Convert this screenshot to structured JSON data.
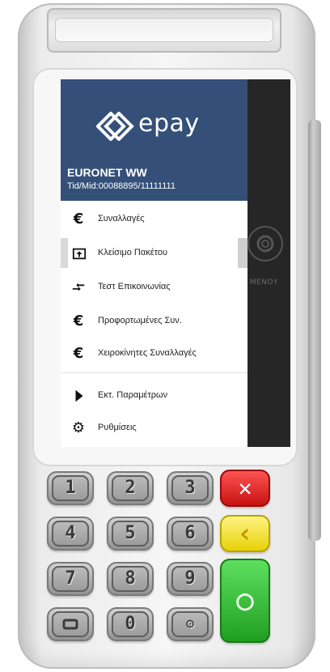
{
  "header": {
    "brand": "epay",
    "company": "EURONET WW",
    "tid_mid": "Tid/Mid:00088895/11111111",
    "color": "#345079"
  },
  "menu": {
    "items": [
      {
        "icon": "euro-icon",
        "label": "Συναλλαγές"
      },
      {
        "icon": "upload-box-icon",
        "label": "Κλείσιμο Πακέτου"
      },
      {
        "icon": "arrows-exchange-icon",
        "label": "Τεστ Επικοινωνίας"
      },
      {
        "icon": "euro-icon",
        "label": "Προφορτωμένες Συν."
      },
      {
        "icon": "euro-icon",
        "label": "Χειροκίνητες Συναλλαγές"
      },
      {
        "icon": "play-right-icon",
        "label": "Εκτ. Παραμέτρων"
      },
      {
        "icon": "gear-icon",
        "label": "Ρυθμίσεις"
      }
    ]
  },
  "background": {
    "ghost_text": "ΣΕ ΜΕΝΟΥ"
  },
  "keypad": {
    "keys": [
      "1",
      "2",
      "3",
      "4",
      "5",
      "6",
      "7",
      "8",
      "9",
      "0"
    ],
    "cancel": "✕",
    "back": "‹",
    "ok": "○",
    "cancel_color": "#e01414",
    "back_color": "#f3e000",
    "ok_color": "#2dbb2d"
  }
}
